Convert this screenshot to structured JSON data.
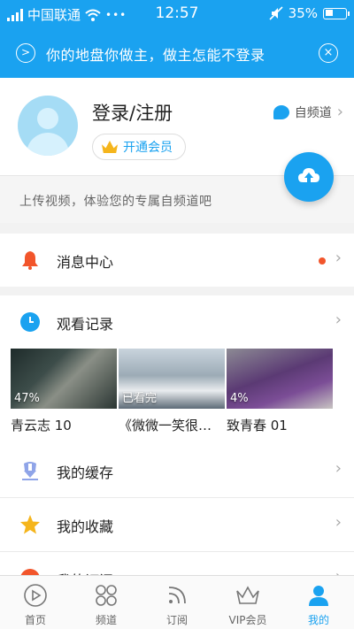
{
  "status_bar": {
    "carrier": "中国联通",
    "time": "12:57",
    "battery": "35%"
  },
  "banner": {
    "text": "你的地盘你做主，做主怎能不登录"
  },
  "profile": {
    "login_label": "登录/注册",
    "vip_label": "开通会员",
    "self_channel_label": "自频道"
  },
  "upload_tip": {
    "text": "上传视频，体验您的专属自频道吧"
  },
  "menu": {
    "messages": "消息中心",
    "history": "观看记录",
    "cache": "我的缓存",
    "favorites": "我的收藏",
    "subscriptions": "我的订阅"
  },
  "history_items": [
    {
      "title": "青云志 10",
      "progress": "47%"
    },
    {
      "title": "《微微一笑很倾城》",
      "progress": "已看完"
    },
    {
      "title": "致青春 01",
      "progress": "4%"
    }
  ],
  "tabs": [
    {
      "label": "首页"
    },
    {
      "label": "频道"
    },
    {
      "label": "订阅"
    },
    {
      "label": "VIP会员"
    },
    {
      "label": "我的"
    }
  ],
  "colors": {
    "brand": "#1aa2f0",
    "alert": "#f2552b",
    "star": "#f5b51c"
  }
}
